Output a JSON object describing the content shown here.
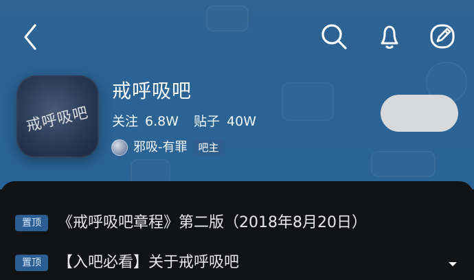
{
  "header": {
    "forum_name": "戒呼吸吧",
    "avatar_text": "戒呼吸吧",
    "stats": {
      "follow_label": "关注",
      "follow_count": "6.8W",
      "posts_label": "贴子",
      "posts_count": "40W"
    },
    "owner": {
      "name": "邪吸-有罪",
      "badge": "吧主"
    }
  },
  "icons": {
    "back": "back-arrow-icon",
    "search": "search-icon",
    "notification": "bell-icon",
    "compose": "edit-icon",
    "expand": "chevron-down-icon"
  },
  "colors": {
    "header_blue": "#2a6394",
    "sheet_dark": "#121315",
    "pin_blue": "#2c5d93",
    "follow_button": "#d7d9dc"
  },
  "pinned_posts": [
    {
      "label": "置顶",
      "title": "《戒呼吸吧章程》第二版（2018年8月20日）"
    },
    {
      "label": "置顶",
      "title": "【入吧必看】关于戒呼吸吧"
    }
  ]
}
